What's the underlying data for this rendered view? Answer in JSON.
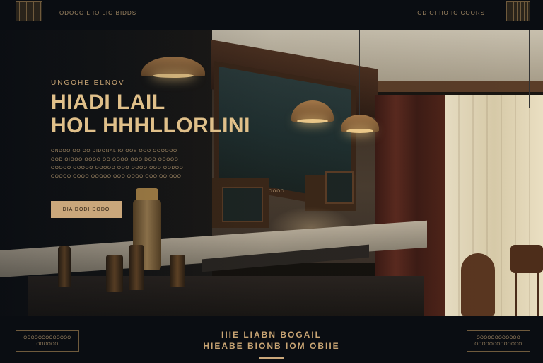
{
  "nav": {
    "left_links": "ODOCO L IO LIO BIDDS",
    "right_links": "ODIOI IIO IO COORS"
  },
  "hero": {
    "eyebrow": "UNGOHE ELNOV",
    "title_line1": "HIADI LAIL",
    "title_line2": "HOL HHHLLORLINI",
    "body_lines": [
      "ONDOO OO OO DIDONAL IO OOS OOO OOOOOO",
      "OOD OIOOO OOOO OO OOOO OOO DOO OOOOO",
      "OOOOO OOOOO OOOOO OOO OOOO OOO OODOO",
      "OOOOO OOOO OOOOO OOO OOOO OOO OO OOO"
    ],
    "cta_label": "DIA DODI DODO",
    "panel_label": "OOOO"
  },
  "footer": {
    "left_box": "OOOOOOOOOOOOO\nOOOOOO",
    "title_line1": "IIIE LIABN BOGAIL",
    "title_line2": "HIEABE BIONB IOM OBIIE",
    "right_box": "OOOOOOOOOOOO\nOOOOOOOOOOOOO"
  },
  "colors": {
    "accent": "#caa77b",
    "background": "#0b0f14",
    "text": "#c9a574"
  }
}
